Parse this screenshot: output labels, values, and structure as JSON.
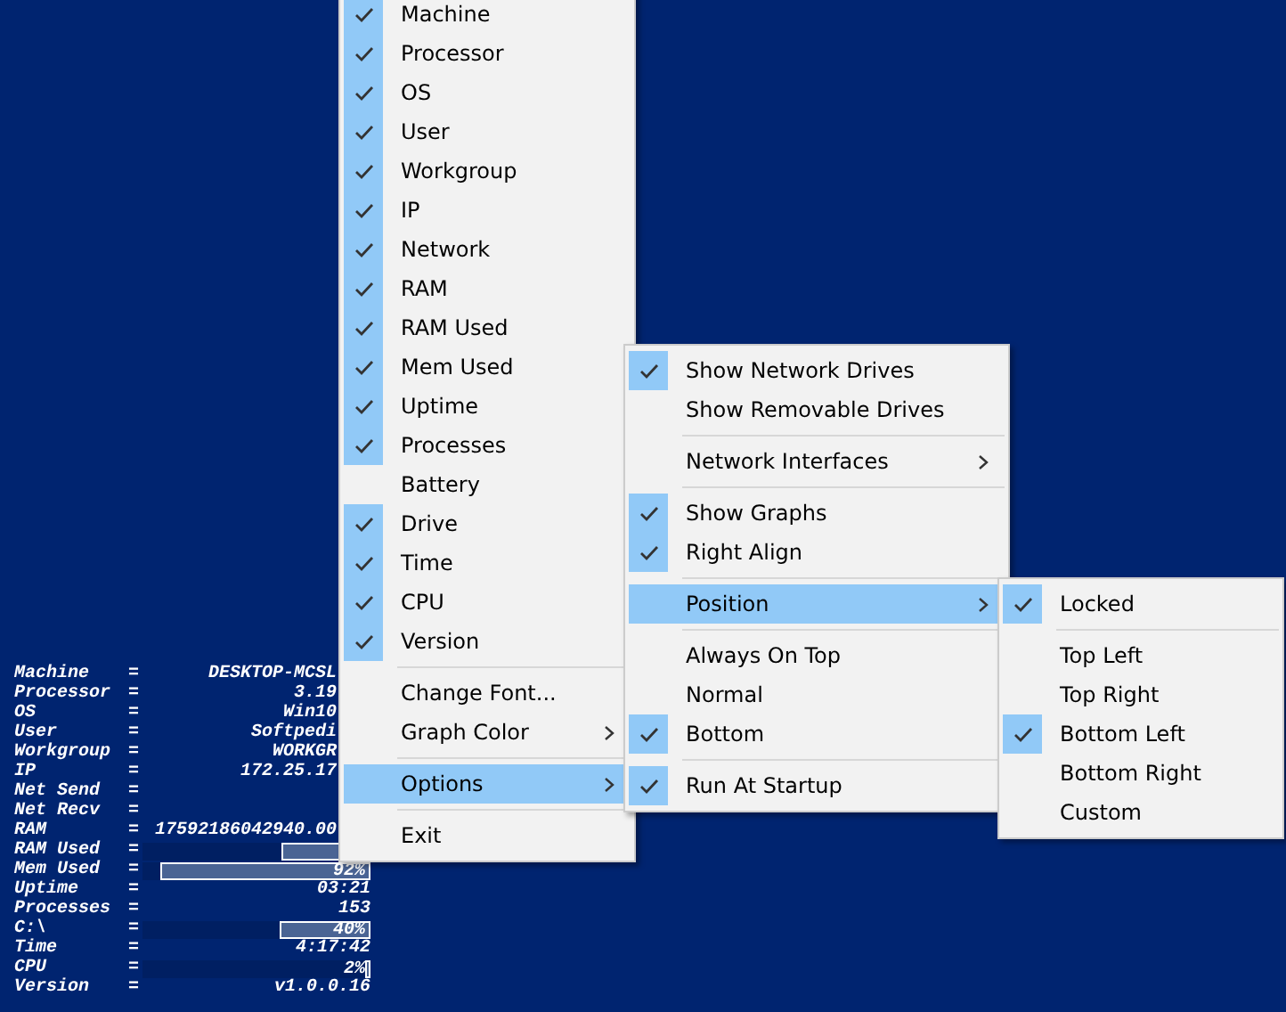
{
  "info_panel": {
    "rows": [
      {
        "label": "Machine",
        "sep": "=",
        "kind": "clipped",
        "value": "DESKTOP-MCSL"
      },
      {
        "label": "Processor",
        "sep": "=",
        "kind": "clipped",
        "value": "3.19"
      },
      {
        "label": "OS",
        "sep": "=",
        "kind": "clipped",
        "value": "Win10"
      },
      {
        "label": "User",
        "sep": "=",
        "kind": "clipped",
        "value": "Softpedi"
      },
      {
        "label": "Workgroup",
        "sep": "=",
        "kind": "clipped",
        "value": "WORKGR"
      },
      {
        "label": "IP",
        "sep": "=",
        "kind": "clipped",
        "value": "172.25.17"
      },
      {
        "label": "Net Send",
        "sep": "=",
        "kind": "text"
      },
      {
        "label": "Net Recv",
        "sep": "=",
        "kind": "text"
      },
      {
        "label": "RAM",
        "sep": "=",
        "kind": "clipped",
        "value": "17592186042940.00"
      },
      {
        "label": "RAM Used",
        "sep": "=",
        "kind": "bar",
        "level": 0.39
      },
      {
        "label": "Mem Used",
        "sep": "=",
        "kind": "bar",
        "level": 0.92,
        "value": "92%"
      },
      {
        "label": "Uptime",
        "sep": "=",
        "kind": "text",
        "value": "03:21"
      },
      {
        "label": "Processes",
        "sep": "=",
        "kind": "text",
        "value": "153"
      },
      {
        "label": "C:\\",
        "sep": "=",
        "kind": "bar",
        "level": 0.4,
        "value": "40%"
      },
      {
        "label": "Time",
        "sep": "=",
        "kind": "text",
        "value": "4:17:42"
      },
      {
        "label": "CPU",
        "sep": "=",
        "kind": "bar",
        "level": 0.02,
        "value": "2%"
      },
      {
        "label": "Version",
        "sep": "=",
        "kind": "text",
        "value": "v1.0.0.16"
      }
    ]
  },
  "main_menu": {
    "items": [
      {
        "kind": "item",
        "label": "Machine",
        "checked": true,
        "submenu": false,
        "selected": false
      },
      {
        "kind": "item",
        "label": "Processor",
        "checked": true,
        "submenu": false,
        "selected": false
      },
      {
        "kind": "item",
        "label": "OS",
        "checked": true,
        "submenu": false,
        "selected": false
      },
      {
        "kind": "item",
        "label": "User",
        "checked": true,
        "submenu": false,
        "selected": false
      },
      {
        "kind": "item",
        "label": "Workgroup",
        "checked": true,
        "submenu": false,
        "selected": false
      },
      {
        "kind": "item",
        "label": "IP",
        "checked": true,
        "submenu": false,
        "selected": false
      },
      {
        "kind": "item",
        "label": "Network",
        "checked": true,
        "submenu": false,
        "selected": false
      },
      {
        "kind": "item",
        "label": "RAM",
        "checked": true,
        "submenu": false,
        "selected": false
      },
      {
        "kind": "item",
        "label": "RAM Used",
        "checked": true,
        "submenu": false,
        "selected": false
      },
      {
        "kind": "item",
        "label": "Mem Used",
        "checked": true,
        "submenu": false,
        "selected": false
      },
      {
        "kind": "item",
        "label": "Uptime",
        "checked": true,
        "submenu": false,
        "selected": false
      },
      {
        "kind": "item",
        "label": "Processes",
        "checked": true,
        "submenu": false,
        "selected": false
      },
      {
        "kind": "item",
        "label": "Battery",
        "checked": false,
        "submenu": false,
        "selected": false
      },
      {
        "kind": "item",
        "label": "Drive",
        "checked": true,
        "submenu": false,
        "selected": false
      },
      {
        "kind": "item",
        "label": "Time",
        "checked": true,
        "submenu": false,
        "selected": false
      },
      {
        "kind": "item",
        "label": "CPU",
        "checked": true,
        "submenu": false,
        "selected": false
      },
      {
        "kind": "item",
        "label": "Version",
        "checked": true,
        "submenu": false,
        "selected": false
      },
      {
        "kind": "separator"
      },
      {
        "kind": "item",
        "label": "Change Font...",
        "checked": false,
        "submenu": false,
        "selected": false
      },
      {
        "kind": "item",
        "label": "Graph Color",
        "checked": false,
        "submenu": true,
        "selected": false
      },
      {
        "kind": "separator"
      },
      {
        "kind": "item",
        "label": "Options",
        "checked": false,
        "submenu": true,
        "selected": true
      },
      {
        "kind": "separator"
      },
      {
        "kind": "item",
        "label": "Exit",
        "checked": false,
        "submenu": false,
        "selected": false
      }
    ]
  },
  "options_menu": {
    "items": [
      {
        "kind": "item",
        "label": "Show Network Drives",
        "checked": true,
        "submenu": false,
        "selected": false
      },
      {
        "kind": "item",
        "label": "Show Removable Drives",
        "checked": false,
        "submenu": false,
        "selected": false
      },
      {
        "kind": "separator"
      },
      {
        "kind": "item",
        "label": "Network Interfaces",
        "checked": false,
        "submenu": true,
        "selected": false
      },
      {
        "kind": "separator"
      },
      {
        "kind": "item",
        "label": "Show Graphs",
        "checked": true,
        "submenu": false,
        "selected": false
      },
      {
        "kind": "item",
        "label": "Right Align",
        "checked": true,
        "submenu": false,
        "selected": false
      },
      {
        "kind": "separator"
      },
      {
        "kind": "item",
        "label": "Position",
        "checked": false,
        "submenu": true,
        "selected": true
      },
      {
        "kind": "separator"
      },
      {
        "kind": "item",
        "label": "Always On Top",
        "checked": false,
        "submenu": false,
        "selected": false
      },
      {
        "kind": "item",
        "label": "Normal",
        "checked": false,
        "submenu": false,
        "selected": false
      },
      {
        "kind": "item",
        "label": "Bottom",
        "checked": true,
        "submenu": false,
        "selected": false
      },
      {
        "kind": "separator"
      },
      {
        "kind": "item",
        "label": "Run At Startup",
        "checked": true,
        "submenu": false,
        "selected": false
      }
    ]
  },
  "position_menu": {
    "items": [
      {
        "kind": "item",
        "label": "Locked",
        "checked": true,
        "submenu": false,
        "selected": false
      },
      {
        "kind": "separator"
      },
      {
        "kind": "item",
        "label": "Top Left",
        "checked": false,
        "submenu": false,
        "selected": false
      },
      {
        "kind": "item",
        "label": "Top Right",
        "checked": false,
        "submenu": false,
        "selected": false
      },
      {
        "kind": "item",
        "label": "Bottom Left",
        "checked": true,
        "submenu": false,
        "selected": false
      },
      {
        "kind": "item",
        "label": "Bottom Right",
        "checked": false,
        "submenu": false,
        "selected": false
      },
      {
        "kind": "item",
        "label": "Custom",
        "checked": false,
        "submenu": false,
        "selected": false
      }
    ]
  }
}
